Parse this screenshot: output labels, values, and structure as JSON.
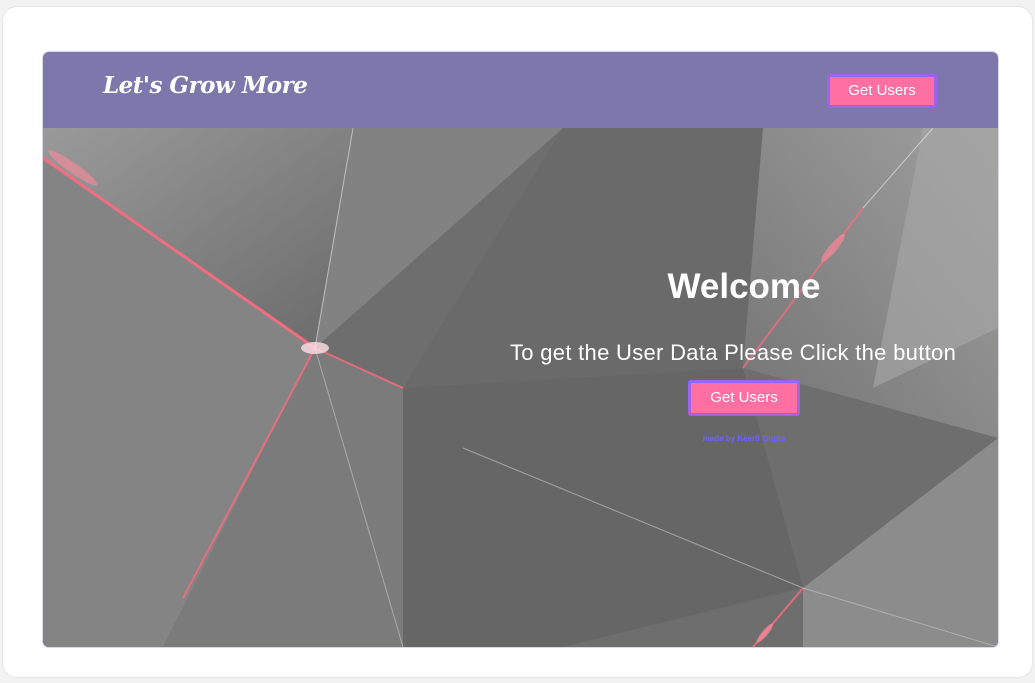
{
  "navbar": {
    "brand": "Let's Grow More",
    "button_label": "Get Users"
  },
  "hero": {
    "title": "Welcome",
    "subtitle": "To get the User Data Please Click the button",
    "button_label": "Get Users",
    "credit": "made by Keerti Gupta"
  },
  "colors": {
    "navbar_bg": "#7e77ab",
    "button_bg": "#ff6fa2",
    "button_border": "#9c63ec",
    "hero_bg": "#707070",
    "credit_text": "#6c63ff"
  }
}
